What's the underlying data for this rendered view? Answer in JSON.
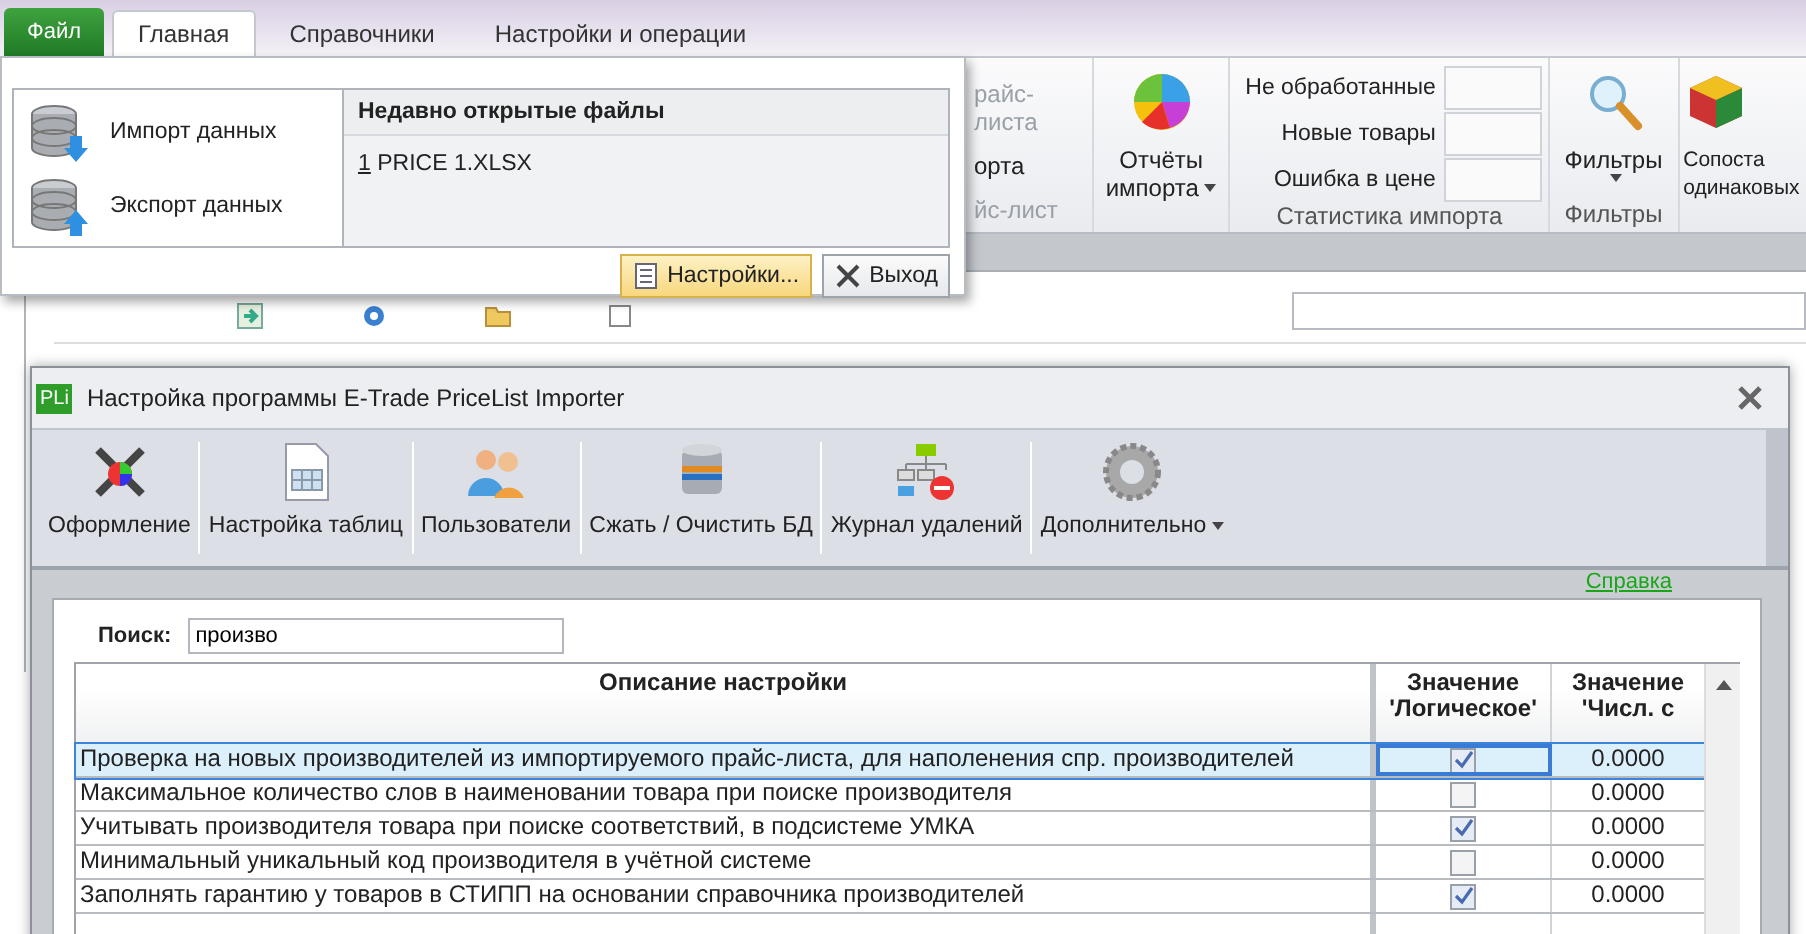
{
  "app_tabs": [
    {
      "label": "Файл",
      "kind": "file",
      "selected": false
    },
    {
      "label": "Главная",
      "kind": "tab",
      "selected": true
    },
    {
      "label": "Справочники",
      "kind": "tab",
      "selected": false
    },
    {
      "label": "Настройки и операции",
      "kind": "tab",
      "selected": false
    }
  ],
  "ribbon": {
    "partial_group": [
      "райс-листа",
      "орта",
      "йс-лист"
    ],
    "reports_button": {
      "line1": "Отчёты",
      "line2": "импорта"
    },
    "import_stats": {
      "title": "Статистика импорта",
      "rows": [
        "Не обработанные",
        "Новые товары",
        "Ошибка в цене"
      ]
    },
    "filters": {
      "button": "Фильтры",
      "title": "Фильтры"
    },
    "compare_button": {
      "line1": "Сопоста",
      "line2": "одинаковых"
    }
  },
  "file_menu": {
    "actions": [
      {
        "label": "Импорт данных",
        "kind": "import"
      },
      {
        "label": "Экспорт данных",
        "kind": "export"
      }
    ],
    "recent_title": "Недавно открытые файлы",
    "recent_files": [
      {
        "number": "1",
        "name": "PRICE 1.XLSX"
      }
    ],
    "buttons": [
      {
        "label": "Настройки...",
        "kind": "settings"
      },
      {
        "label": "Выход",
        "kind": "exit"
      }
    ]
  },
  "dialog": {
    "icon_label": "PLi",
    "title": "Настройка программы E-Trade PriceList Importer",
    "toolbar": [
      {
        "label": "Оформление",
        "kind": "design"
      },
      {
        "label": "Настройка таблиц",
        "kind": "tables"
      },
      {
        "label": "Пользователи",
        "kind": "users"
      },
      {
        "label": "Сжать / Очистить БД",
        "kind": "db"
      },
      {
        "label": "Журнал удалений",
        "kind": "log"
      },
      {
        "label": "Дополнительно",
        "kind": "more"
      }
    ],
    "help_link": "Справка",
    "search": {
      "label": "Поиск:",
      "value": "произво"
    },
    "columns": [
      "Описание настройки",
      "Значение 'Логическое'",
      "Значение 'Числ. с"
    ],
    "rows": [
      {
        "description": "Проверка на новых производителей из импортируемого прайс-листа, для наполенения спр. производителей",
        "checked": true,
        "number": "0.0000",
        "selected": true
      },
      {
        "description": "Максимальное количество слов в наименовании товара при поиске производителя",
        "checked": false,
        "number": "0.0000",
        "selected": false
      },
      {
        "description": "Учитывать производителя товара при поиске соответствий, в подсистеме УМКА",
        "checked": true,
        "number": "0.0000",
        "selected": false
      },
      {
        "description": "Минимальный уникальный код производителя в учётной системе",
        "checked": false,
        "number": "0.0000",
        "selected": false
      },
      {
        "description": "Заполнять гарантию у товаров в СТИПП на основании справочника производителей",
        "checked": true,
        "number": "0.0000",
        "selected": false
      }
    ]
  }
}
